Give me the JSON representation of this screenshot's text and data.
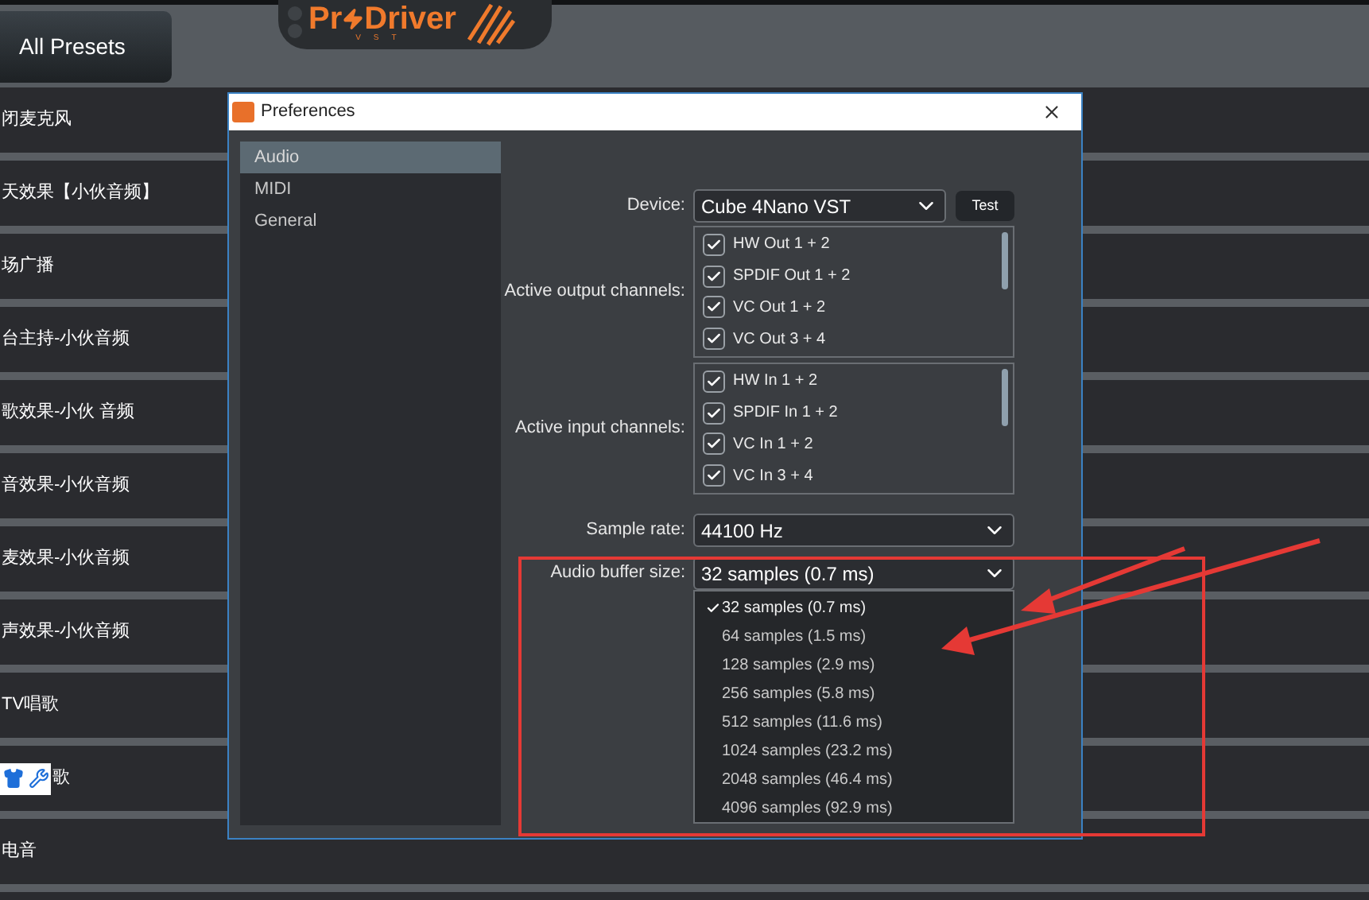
{
  "header": {
    "presets_button": "All Presets",
    "logo": {
      "text_start": "Pr",
      "text_end": "Driver",
      "subtitle": "VST"
    }
  },
  "presets": [
    {
      "name": "闭麦克风",
      "tool_icons": false
    },
    {
      "name": "天效果【小伙音频】",
      "tool_icons": false
    },
    {
      "name": "场广播",
      "tool_icons": false
    },
    {
      "name": "台主持-小伙音频",
      "tool_icons": false
    },
    {
      "name": "歌效果-小伙 音频",
      "tool_icons": false
    },
    {
      "name": "音效果-小伙音频",
      "tool_icons": false
    },
    {
      "name": "麦效果-小伙音频",
      "tool_icons": false
    },
    {
      "name": "声效果-小伙音频",
      "tool_icons": false
    },
    {
      "name": "TV唱歌",
      "tool_icons": false
    },
    {
      "name": "歌",
      "tool_icons": true
    },
    {
      "name": "电音",
      "tool_icons": false
    }
  ],
  "dialog": {
    "title": "Preferences",
    "nav": [
      {
        "label": "Audio",
        "selected": true
      },
      {
        "label": "MIDI",
        "selected": false
      },
      {
        "label": "General",
        "selected": false
      }
    ],
    "device": {
      "label": "Device:",
      "value": "Cube 4Nano VST",
      "button": "Test"
    },
    "output_channels": {
      "label": "Active output channels:",
      "items": [
        {
          "label": "HW Out 1 + 2",
          "checked": true
        },
        {
          "label": "SPDIF Out 1 + 2",
          "checked": true
        },
        {
          "label": "VC Out 1 + 2",
          "checked": true
        },
        {
          "label": "VC Out 3 + 4",
          "checked": true
        }
      ]
    },
    "input_channels": {
      "label": "Active input channels:",
      "items": [
        {
          "label": "HW In 1 + 2",
          "checked": true
        },
        {
          "label": "SPDIF In 1 + 2",
          "checked": true
        },
        {
          "label": "VC In 1 + 2",
          "checked": true
        },
        {
          "label": "VC In 3 + 4",
          "checked": true
        }
      ]
    },
    "sample_rate": {
      "label": "Sample rate:",
      "value": "44100 Hz"
    },
    "buffer_size": {
      "label": "Audio buffer size:",
      "value": "32 samples (0.7 ms)",
      "expanded": true,
      "options": [
        {
          "label": "32 samples (0.7 ms)",
          "selected": true
        },
        {
          "label": "64 samples (1.5 ms)",
          "selected": false
        },
        {
          "label": "128 samples (2.9 ms)",
          "selected": false
        },
        {
          "label": "256 samples (5.8 ms)",
          "selected": false
        },
        {
          "label": "512 samples (11.6 ms)",
          "selected": false
        },
        {
          "label": "1024 samples (23.2 ms)",
          "selected": false
        },
        {
          "label": "2048 samples (46.4 ms)",
          "selected": false
        },
        {
          "label": "4096 samples (92.9 ms)",
          "selected": false
        }
      ]
    }
  }
}
